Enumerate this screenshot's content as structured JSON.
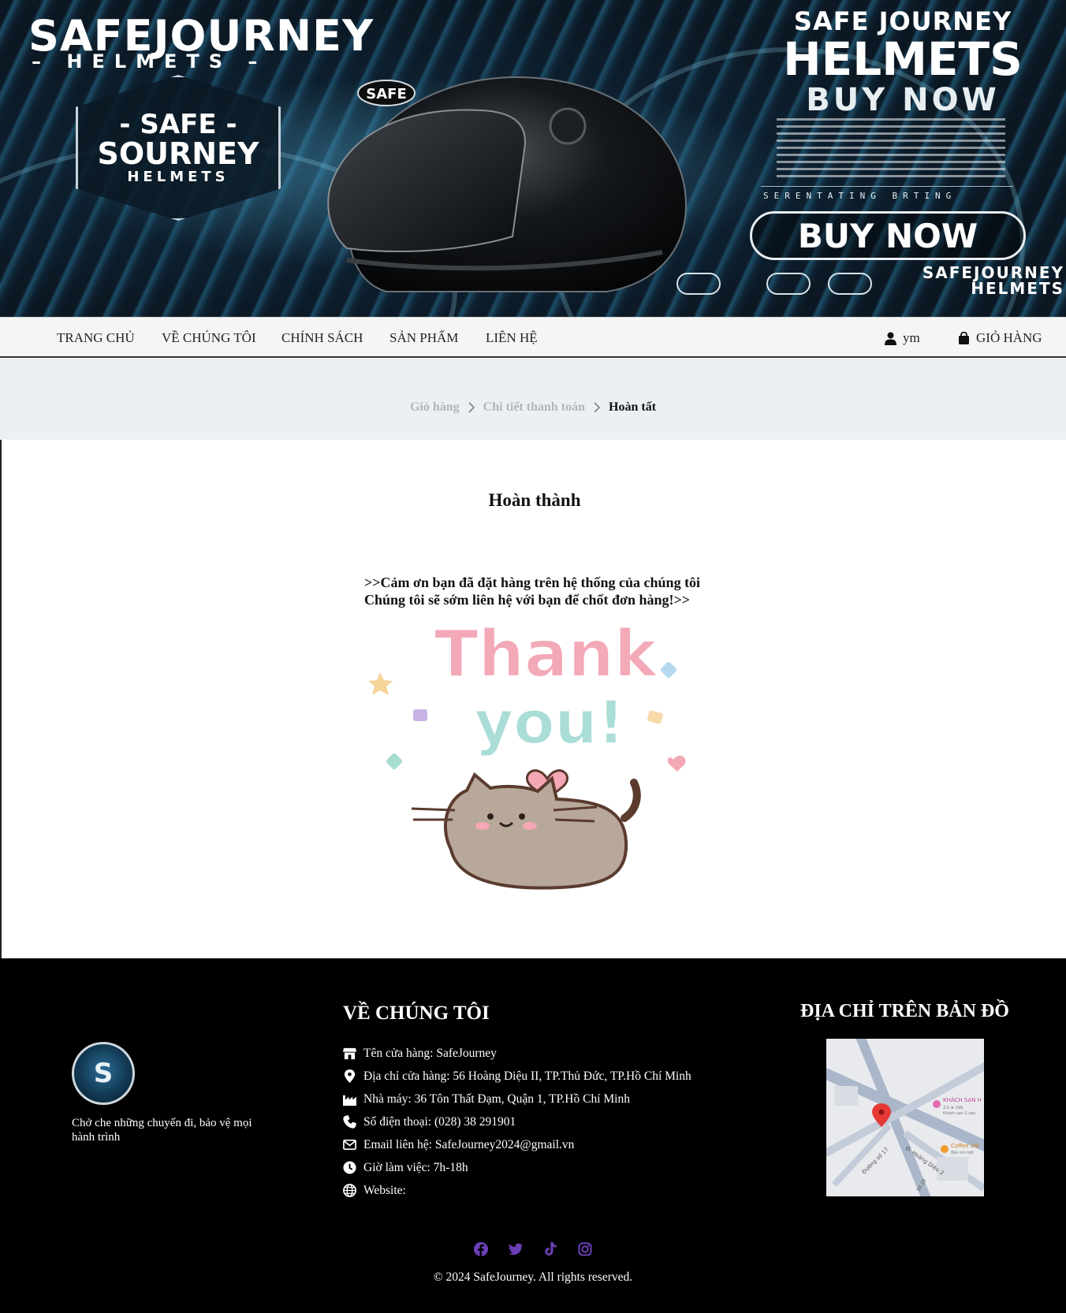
{
  "banner": {
    "brand_big": "SAFEJOURNEY",
    "brand_sub": "HELMETS",
    "badge_line1": "- SAFE -",
    "badge_line2": "SOURNEY",
    "badge_line3": "HELMETS",
    "helmet_logo": "SAFE",
    "right_line1": "SAFE JOURNEY",
    "right_line2": "HELMETS",
    "right_line3": "BUY NOW",
    "caps_line": "SERENTATING BRTING",
    "cta": "BUY NOW",
    "bottom_brand1": "SAFEJOURNEY",
    "bottom_brand2": "HELMETS"
  },
  "nav": {
    "items": [
      "TRANG CHỦ",
      "VỀ CHÚNG TÔI",
      "CHÍNH SÁCH",
      "SẢN PHẨM",
      "LIÊN HỆ"
    ],
    "user": "ym",
    "cart": "GIỎ HÀNG"
  },
  "breadcrumb": {
    "step1": "Giỏ hàng",
    "step2": "Chi tiết thanh toán",
    "step3": "Hoàn tất"
  },
  "main": {
    "title": "Hoàn thành",
    "message_line1": ">>Cảm ơn bạn đã đặt hàng trên hệ thống của chúng tôi",
    "message_line2": "Chúng tôi sẽ sớm liên hệ với bạn để chốt đơn hàng!>>",
    "art_word1": "Thank",
    "art_word2": "you!"
  },
  "footer": {
    "logo_letter": "S",
    "tagline": "Chở che những chuyến đi, bảo vệ mọi hành trình",
    "about_title": "VỀ CHÚNG TÔI",
    "about": [
      {
        "icon": "store-icon",
        "text": "Tên cửa hàng: SafeJourney"
      },
      {
        "icon": "location-pin-icon",
        "text": "Địa chỉ cửa hàng: 56 Hoàng Diệu II, TP.Thủ Đức, TP.Hồ Chí Minh"
      },
      {
        "icon": "factory-icon",
        "text": "Nhà máy: 36 Tôn Thất Đạm, Quận 1, TP.Hồ Chí Minh"
      },
      {
        "icon": "phone-icon",
        "text": "Số điện thoại: (028) 38 291901"
      },
      {
        "icon": "envelope-icon",
        "text": "Email liên hệ: SafeJourney2024@gmail.vn"
      },
      {
        "icon": "clock-icon",
        "text": "Giờ làm việc: 7h-18h"
      },
      {
        "icon": "globe-icon",
        "text": "Website:"
      }
    ],
    "map_title": "ĐỊA CHỈ TRÊN BẢN ĐỒ",
    "map_labels": {
      "hotel": "KHÁCH SẠN H",
      "hotel_rating": "3.5 ★ (68)",
      "hotel_sub": "Khách sạn 2 sao",
      "coffee": "Coffee 24/",
      "coffee_sub": "Bàn ion hết",
      "street1": "Đường số 17",
      "street2": "Đ. Hoàng Diệu 2",
      "street3": "Số 20"
    },
    "socials": [
      "facebook-icon",
      "twitter-icon",
      "tiktok-icon",
      "instagram-icon"
    ],
    "copyright": "© 2024 SafeJourney. All rights reserved."
  },
  "colors": {
    "nav_bg": "#f5f5f5",
    "crumb_bg": "#edf0f3",
    "footer_bg": "#000000",
    "social_accent": "#6b3fb6"
  }
}
